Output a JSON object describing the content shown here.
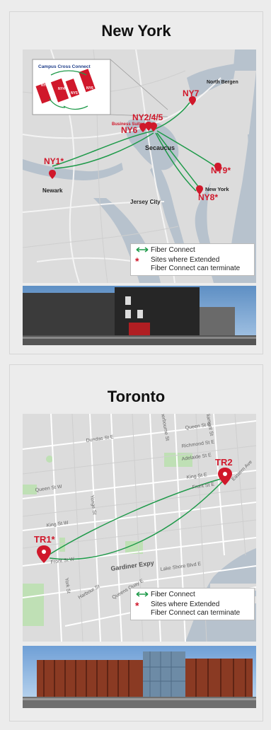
{
  "newyork": {
    "title": "New York",
    "inset_title": "Campus Cross Connect",
    "inset_buildings": [
      "NY2",
      "NY4",
      "NY5",
      "NY6"
    ],
    "labels": {
      "ny1": "NY1*",
      "ny6": "NY6",
      "ny245": "NY2/4/5",
      "ny7": "NY7",
      "ny8": "NY8*",
      "ny9": "NY9*",
      "business_suites": "Business Suites",
      "secaucus": "Secaucus",
      "newark": "Newark",
      "jersey_city": "Jersey City",
      "new_york": "New York",
      "north_bergen": "North Bergen"
    },
    "legend": {
      "fiber": "Fiber Connect",
      "sites_line1": "Sites where Extended",
      "sites_line2": "Fiber Connect can terminate"
    }
  },
  "toronto": {
    "title": "Toronto",
    "labels": {
      "tr1": "TR1*",
      "tr2": "TR2",
      "dundas": "Dundas St E",
      "queen_e": "Queen St E",
      "richmond": "Richmond St E",
      "adelaide": "Adelaide St E",
      "king_e": "King St E",
      "front_e": "Front St E",
      "eastern": "Eastern Ave",
      "sherbourne": "Sherbourne St",
      "parliament": "Parliament St",
      "queen_w": "Queen St W",
      "king_w": "King St W",
      "front_w": "Front St W",
      "yonge": "Yonge St",
      "york": "York St",
      "harbour": "Harbour St",
      "gardiner": "Gardiner Expy",
      "lakeshore": "Lake Shore Blvd E",
      "queens_quay": "Queens Quay E"
    },
    "legend": {
      "fiber": "Fiber Connect",
      "sites_line1": "Sites where Extended",
      "sites_line2": "Fiber Connect can terminate"
    }
  },
  "colors": {
    "pin_red": "#d0182b",
    "route_green": "#1f9a4a",
    "water": "#b7c2cd",
    "land": "#dcdcdc",
    "park": "#bfe0b5"
  }
}
